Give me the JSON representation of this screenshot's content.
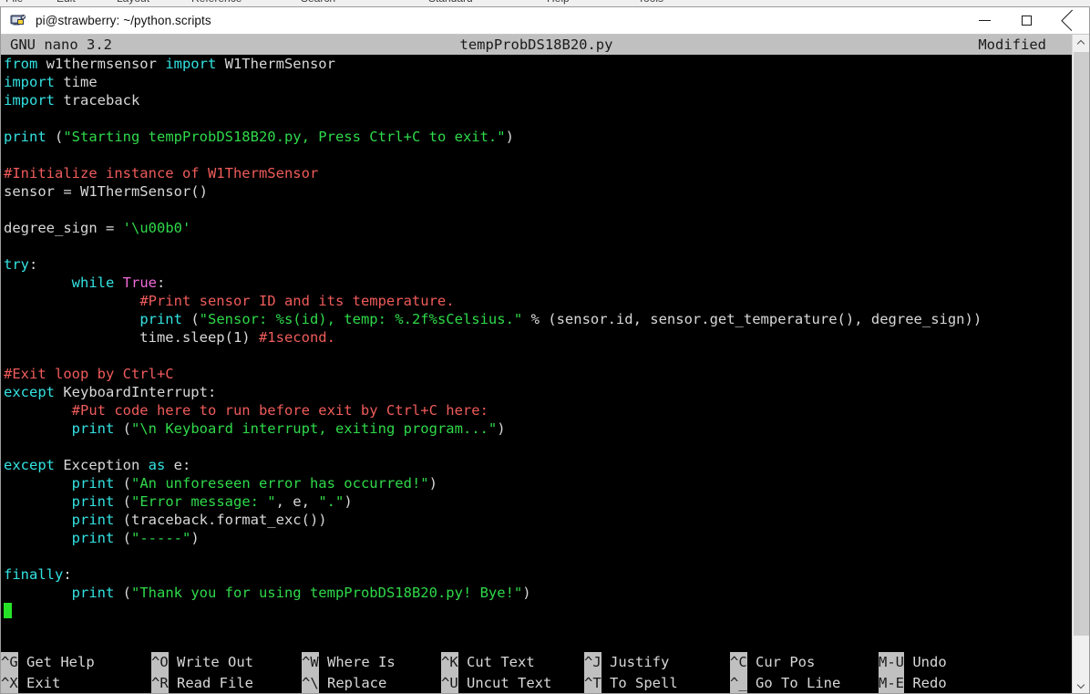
{
  "background_menubar": {
    "items": [
      "File",
      "Edit",
      "Layout",
      "Reference",
      "Search",
      "Standard",
      "Help",
      "Tools"
    ]
  },
  "window": {
    "title": "pi@strawberry: ~/python.scripts",
    "icon": "putty-terminal-icon",
    "controls": {
      "minimize": "minimize-icon",
      "maximize": "maximize-icon",
      "close": "close-icon"
    }
  },
  "editor": {
    "header": {
      "app_version": "GNU nano 3.2",
      "filename": "tempProbDS18B20.py",
      "status": "Modified"
    },
    "cursor": {
      "line": 27,
      "column": 1
    },
    "code_lines": [
      [
        {
          "t": "from",
          "c": "kw"
        },
        {
          "t": " w1thermsensor ",
          "c": "id"
        },
        {
          "t": "import",
          "c": "kw"
        },
        {
          "t": " W1ThermSensor",
          "c": "id"
        }
      ],
      [
        {
          "t": "import",
          "c": "kw"
        },
        {
          "t": " time",
          "c": "id"
        }
      ],
      [
        {
          "t": "import",
          "c": "kw"
        },
        {
          "t": " traceback",
          "c": "id"
        }
      ],
      [],
      [
        {
          "t": "print",
          "c": "kw"
        },
        {
          "t": " (",
          "c": "id"
        },
        {
          "t": "\"Starting tempProbDS18B20.py, Press Ctrl+C to exit.\"",
          "c": "str"
        },
        {
          "t": ")",
          "c": "id"
        }
      ],
      [],
      [
        {
          "t": "#Initialize instance of W1ThermSensor",
          "c": "com"
        }
      ],
      [
        {
          "t": "sensor = W1ThermSensor()",
          "c": "id"
        }
      ],
      [],
      [
        {
          "t": "degree_sign = ",
          "c": "id"
        },
        {
          "t": "'\\u00b0'",
          "c": "str"
        }
      ],
      [],
      [
        {
          "t": "try",
          "c": "kw"
        },
        {
          "t": ":",
          "c": "id"
        }
      ],
      [
        {
          "t": "        ",
          "c": "id"
        },
        {
          "t": "while",
          "c": "kw"
        },
        {
          "t": " ",
          "c": "id"
        },
        {
          "t": "True",
          "c": "const"
        },
        {
          "t": ":",
          "c": "id"
        }
      ],
      [
        {
          "t": "                ",
          "c": "id"
        },
        {
          "t": "#Print sensor ID and its temperature.",
          "c": "com"
        }
      ],
      [
        {
          "t": "                ",
          "c": "id"
        },
        {
          "t": "print",
          "c": "kw"
        },
        {
          "t": " (",
          "c": "id"
        },
        {
          "t": "\"Sensor: %s(id), temp: %.2f%sCelsius.\"",
          "c": "str"
        },
        {
          "t": " % (sensor.id, sensor.get_temperature(), degree_sign))",
          "c": "id"
        }
      ],
      [
        {
          "t": "                time.sleep(1) ",
          "c": "id"
        },
        {
          "t": "#1second.",
          "c": "com"
        }
      ],
      [],
      [
        {
          "t": "#Exit loop by Ctrl+C",
          "c": "com"
        }
      ],
      [
        {
          "t": "except",
          "c": "kw"
        },
        {
          "t": " KeyboardInterrupt:",
          "c": "id"
        }
      ],
      [
        {
          "t": "        ",
          "c": "id"
        },
        {
          "t": "#Put code here to run before exit by Ctrl+C here:",
          "c": "com"
        }
      ],
      [
        {
          "t": "        ",
          "c": "id"
        },
        {
          "t": "print",
          "c": "kw"
        },
        {
          "t": " (",
          "c": "id"
        },
        {
          "t": "\"\\n Keyboard interrupt, exiting program...\"",
          "c": "str"
        },
        {
          "t": ")",
          "c": "id"
        }
      ],
      [],
      [
        {
          "t": "except",
          "c": "kw"
        },
        {
          "t": " Exception ",
          "c": "id"
        },
        {
          "t": "as",
          "c": "kw"
        },
        {
          "t": " e:",
          "c": "id"
        }
      ],
      [
        {
          "t": "        ",
          "c": "id"
        },
        {
          "t": "print",
          "c": "kw"
        },
        {
          "t": " (",
          "c": "id"
        },
        {
          "t": "\"An unforeseen error has occurred!\"",
          "c": "str"
        },
        {
          "t": ")",
          "c": "id"
        }
      ],
      [
        {
          "t": "        ",
          "c": "id"
        },
        {
          "t": "print",
          "c": "kw"
        },
        {
          "t": " (",
          "c": "id"
        },
        {
          "t": "\"Error message: \"",
          "c": "str"
        },
        {
          "t": ", e, ",
          "c": "id"
        },
        {
          "t": "\".\"",
          "c": "str"
        },
        {
          "t": ")",
          "c": "id"
        }
      ],
      [
        {
          "t": "        ",
          "c": "id"
        },
        {
          "t": "print",
          "c": "kw"
        },
        {
          "t": " (traceback.format_exc())",
          "c": "id"
        }
      ],
      [
        {
          "t": "        ",
          "c": "id"
        },
        {
          "t": "print",
          "c": "kw"
        },
        {
          "t": " (",
          "c": "id"
        },
        {
          "t": "\"-----\"",
          "c": "str"
        },
        {
          "t": ")",
          "c": "id"
        }
      ],
      [],
      [
        {
          "t": "finally",
          "c": "kw"
        },
        {
          "t": ":",
          "c": "id"
        }
      ],
      [
        {
          "t": "        ",
          "c": "id"
        },
        {
          "t": "print",
          "c": "kw"
        },
        {
          "t": " (",
          "c": "id"
        },
        {
          "t": "\"Thank you for using tempProbDS18B20.py! Bye!\"",
          "c": "str"
        },
        {
          "t": ")",
          "c": "id"
        }
      ],
      [
        "CURSOR"
      ]
    ],
    "shortcuts": [
      {
        "key": "^G",
        "label": "Get Help",
        "col": 0,
        "row": 0
      },
      {
        "key": "^O",
        "label": "Write Out",
        "col": 1,
        "row": 0
      },
      {
        "key": "^W",
        "label": "Where Is",
        "col": 2,
        "row": 0
      },
      {
        "key": "^K",
        "label": "Cut Text",
        "col": 3,
        "row": 0
      },
      {
        "key": "^J",
        "label": "Justify",
        "col": 4,
        "row": 0
      },
      {
        "key": "^C",
        "label": "Cur Pos",
        "col": 5,
        "row": 0
      },
      {
        "key": "M-U",
        "label": "Undo",
        "col": 6,
        "row": 0
      },
      {
        "key": "^X",
        "label": "Exit",
        "col": 0,
        "row": 1
      },
      {
        "key": "^R",
        "label": "Read File",
        "col": 1,
        "row": 1
      },
      {
        "key": "^\\",
        "label": "Replace",
        "col": 2,
        "row": 1
      },
      {
        "key": "^U",
        "label": "Uncut Text",
        "col": 3,
        "row": 1
      },
      {
        "key": "^T",
        "label": "To Spell",
        "col": 4,
        "row": 1
      },
      {
        "key": "^_",
        "label": "Go To Line",
        "col": 5,
        "row": 1
      },
      {
        "key": "M-E",
        "label": "Redo",
        "col": 6,
        "row": 1
      }
    ]
  },
  "scrollbar": {
    "up_arrow": "chevron-up-icon",
    "down_arrow": "chevron-down-icon"
  },
  "colors": {
    "terminal_bg": "#000000",
    "keyword": "#34e2e2",
    "string": "#2fd94a",
    "comment": "#f05b5b",
    "constant": "#f06bd8",
    "identifier": "#d8d8d8",
    "bar_bg": "#c0c0c0",
    "cursor": "#27e327"
  }
}
